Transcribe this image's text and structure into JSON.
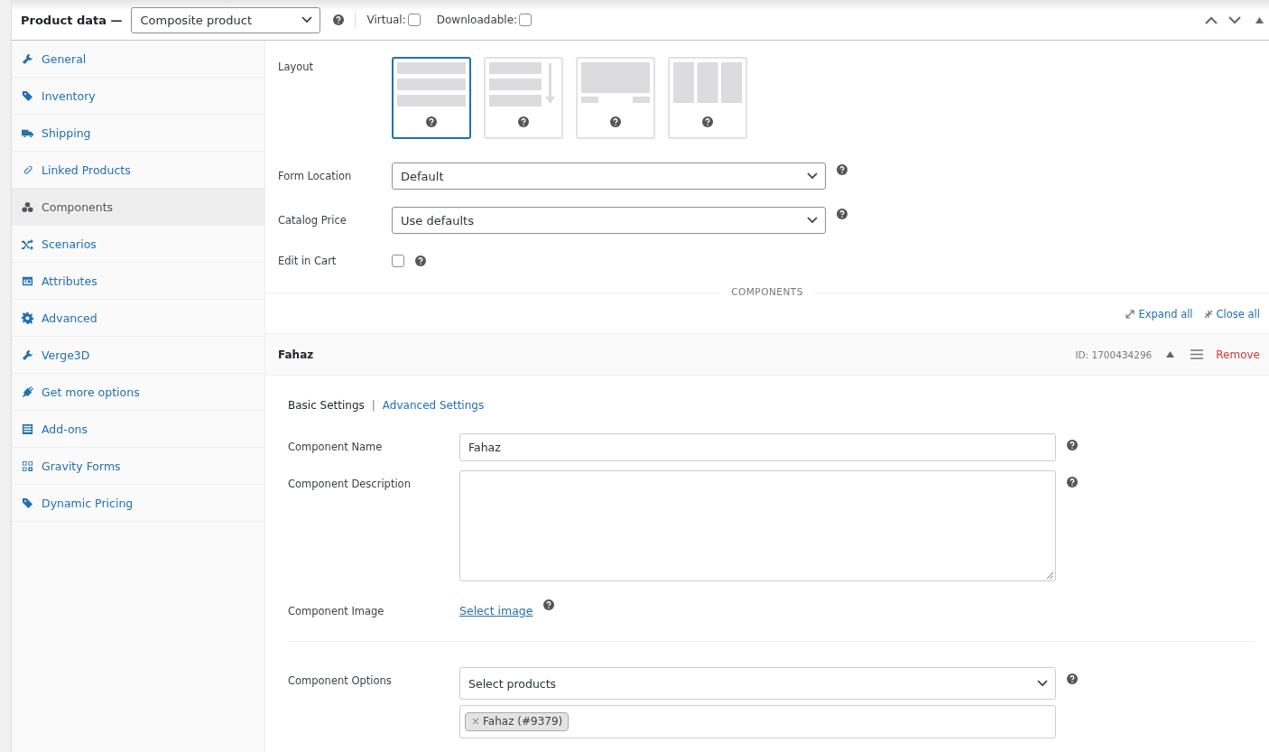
{
  "header": {
    "title": "Product data —",
    "product_type": "Composite product",
    "virtual": {
      "label": "Virtual:",
      "checked": false
    },
    "downloadable": {
      "label": "Downloadable:",
      "checked": false
    }
  },
  "sidebar": {
    "items": [
      {
        "label": "General",
        "selected": false
      },
      {
        "label": "Inventory",
        "selected": false
      },
      {
        "label": "Shipping",
        "selected": false
      },
      {
        "label": "Linked Products",
        "selected": false
      },
      {
        "label": "Components",
        "selected": true
      },
      {
        "label": "Scenarios",
        "selected": false
      },
      {
        "label": "Attributes",
        "selected": false
      },
      {
        "label": "Advanced",
        "selected": false
      },
      {
        "label": "Verge3D",
        "selected": false
      },
      {
        "label": "Get more options",
        "selected": false
      },
      {
        "label": "Add-ons",
        "selected": false
      },
      {
        "label": "Gravity Forms",
        "selected": false
      },
      {
        "label": "Dynamic Pricing",
        "selected": false
      }
    ]
  },
  "layout": {
    "label": "Layout",
    "options": [
      {
        "kind": "stacked",
        "selected": true
      },
      {
        "kind": "progressive",
        "selected": false
      },
      {
        "kind": "tabbed",
        "selected": false
      },
      {
        "kind": "columns",
        "selected": false
      }
    ]
  },
  "form_location": {
    "label": "Form Location",
    "value": "Default"
  },
  "catalog_price": {
    "label": "Catalog Price",
    "value": "Use defaults"
  },
  "edit_in_cart": {
    "label": "Edit in Cart",
    "checked": false
  },
  "components_heading": "COMPONENTS",
  "expand_all": "Expand all",
  "close_all": "Close all",
  "component": {
    "title": "Fahaz",
    "id": "ID: 1700434296",
    "remove": "Remove",
    "tabs": [
      {
        "label": "Basic Settings",
        "selected": true
      },
      {
        "label": "Advanced Settings",
        "selected": false
      }
    ],
    "tab_separator": "|",
    "name": {
      "label": "Component Name",
      "value": "Fahaz"
    },
    "description": {
      "label": "Component Description"
    },
    "image": {
      "label": "Component Image",
      "link": "Select image"
    },
    "options": {
      "label": "Component Options",
      "select": "Select products",
      "tokens": [
        {
          "remove": "×",
          "label": "Fahaz (#9379)"
        }
      ]
    }
  }
}
